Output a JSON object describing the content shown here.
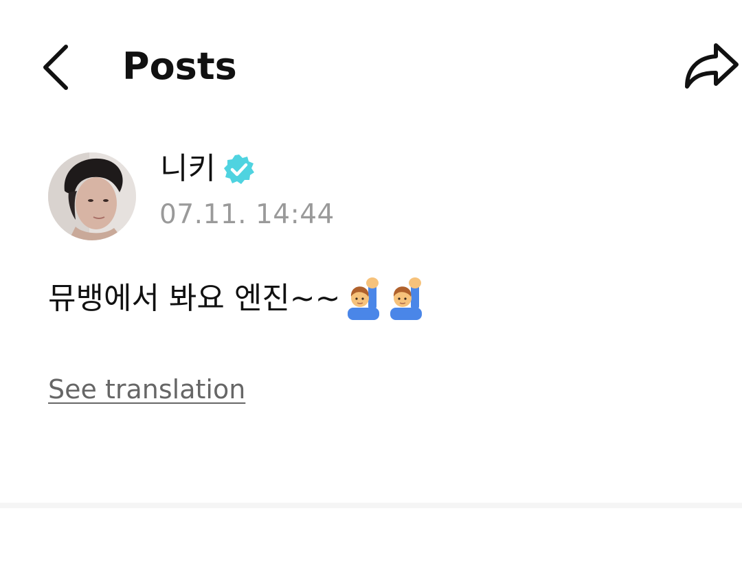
{
  "header": {
    "title": "Posts",
    "back_icon": "chevron-left-icon",
    "share_icon": "share-arrow-icon"
  },
  "post": {
    "author_name": "니키",
    "verified_icon": "verified-badge-icon",
    "verified_color": "#4fd3e0",
    "timestamp": "07.11. 14:44",
    "body_text": "뮤뱅에서 봐요 엔진~~",
    "emojis": [
      "person-raising-hand-emoji",
      "person-raising-hand-emoji"
    ],
    "see_translation_label": "See translation"
  },
  "colors": {
    "background": "#ffffff",
    "text_primary": "#111111",
    "text_secondary": "#9a9a9a",
    "link": "#666666",
    "divider": "#f5f5f5"
  }
}
